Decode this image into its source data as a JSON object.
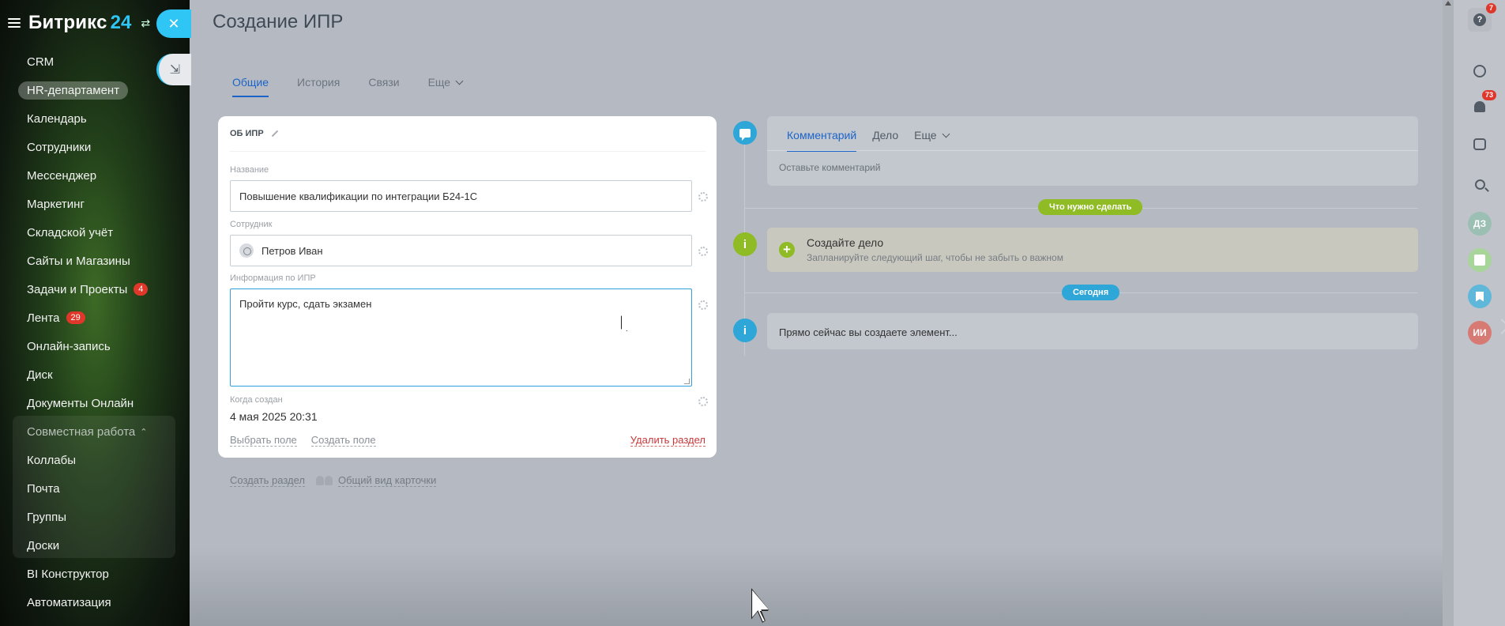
{
  "brand": {
    "name": "Битрикс",
    "number": "24"
  },
  "sidebar": {
    "items": [
      {
        "label": "CRM"
      },
      {
        "label": "HR-департамент",
        "active": true
      },
      {
        "label": "Календарь"
      },
      {
        "label": "Сотрудники"
      },
      {
        "label": "Мессенджер"
      },
      {
        "label": "Маркетинг"
      },
      {
        "label": "Складской учёт"
      },
      {
        "label": "Сайты и Магазины"
      },
      {
        "label": "Задачи и Проекты",
        "badge": "4"
      },
      {
        "label": "Лента",
        "badge": "29"
      },
      {
        "label": "Онлайн-запись"
      },
      {
        "label": "Диск"
      },
      {
        "label": "Документы Онлайн"
      },
      {
        "label": "Совместная работа",
        "group_head": true
      },
      {
        "label": "Коллабы"
      },
      {
        "label": "Почта"
      },
      {
        "label": "Группы"
      },
      {
        "label": "Доски"
      },
      {
        "label": "BI Конструктор"
      },
      {
        "label": "Автоматизация"
      }
    ]
  },
  "page": {
    "title": "Создание ИПР",
    "tabs": [
      {
        "label": "Общие",
        "active": true
      },
      {
        "label": "История"
      },
      {
        "label": "Связи"
      },
      {
        "label": "Еще"
      }
    ]
  },
  "card": {
    "header": "ОБ ИПР",
    "name_label": "Название",
    "name_value": "Повышение квалификации по интеграции Б24-1С",
    "employee_label": "Сотрудник",
    "employee_value": "Петров Иван",
    "info_label": "Информация по ИПР",
    "info_value": "Пройти курс, сдать экзамен",
    "created_label": "Когда создан",
    "created_value": "4 мая 2025 20:31",
    "select_field": "Выбрать поле",
    "create_field": "Создать поле",
    "delete_section": "Удалить раздел"
  },
  "under_card": {
    "create_section": "Создать раздел",
    "common_view": "Общий вид карточки"
  },
  "timeline": {
    "comment_tabs": [
      {
        "label": "Комментарий",
        "active": true
      },
      {
        "label": "Дело"
      },
      {
        "label": "Еще"
      }
    ],
    "comment_placeholder": "Оставьте комментарий",
    "todo_pill": "Что нужно сделать",
    "todo_title": "Создайте дело",
    "todo_sub": "Запланируйте следующий шаг, чтобы не забыть о важном",
    "today_pill": "Сегодня",
    "now_text": "Прямо сейчас вы создаете элемент..."
  },
  "right_bar": {
    "help_badge": "7",
    "bell_badge": "73",
    "avatar_dz": "ДЗ",
    "avatar_ii": "ИИ"
  },
  "colors": {
    "accent": "#2fc6f6",
    "link_active": "#1c64c8",
    "todo_green": "#8fbb24",
    "delete_red": "#c8373a",
    "badge_red": "#e0372b"
  },
  "icons": {
    "close": "close-icon",
    "minimize": "minimize-icon",
    "gear": "gear-icon",
    "pencil": "pencil-icon",
    "search": "search-icon",
    "bell": "bell-icon"
  }
}
